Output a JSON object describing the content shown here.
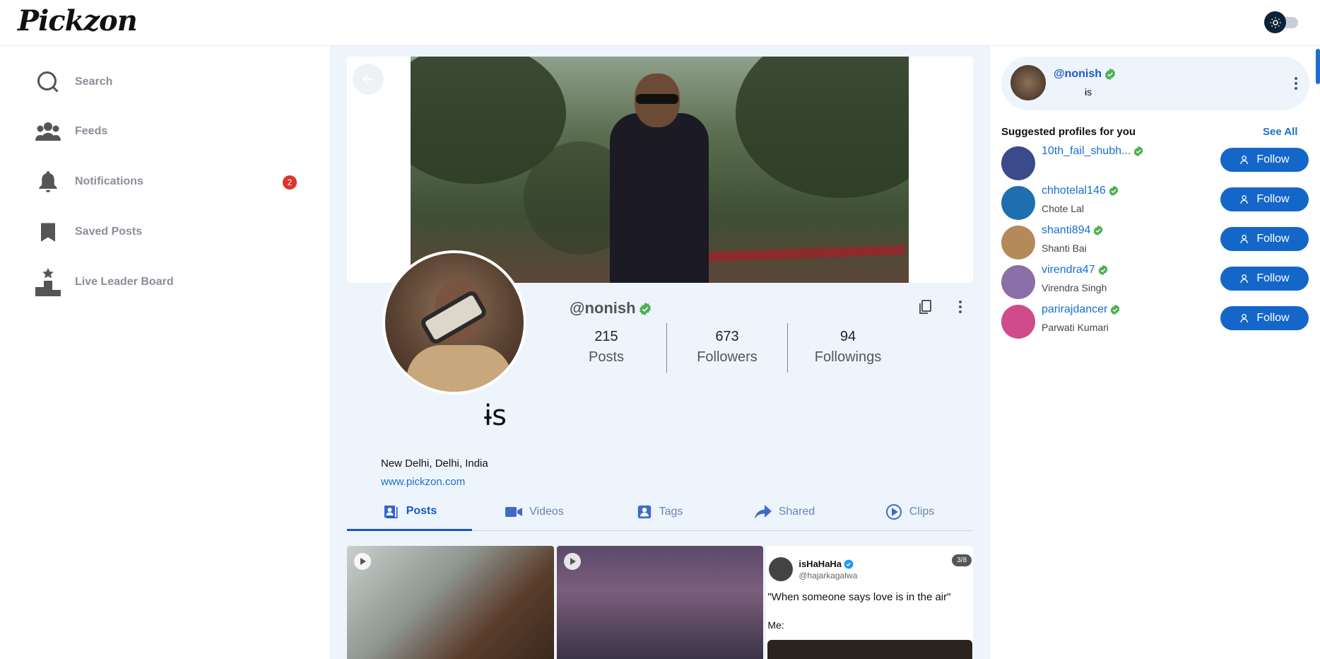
{
  "app": {
    "logo": "Pickzon"
  },
  "header": {
    "theme_toggle": "sun-icon"
  },
  "sidebar": {
    "items": [
      {
        "label": "Search",
        "icon": "search-icon"
      },
      {
        "label": "Feeds",
        "icon": "people-icon"
      },
      {
        "label": "Notifications",
        "icon": "bell-icon",
        "badge": "2"
      },
      {
        "label": "Saved Posts",
        "icon": "bookmark-icon"
      },
      {
        "label": "Live Leader Board",
        "icon": "podium-icon"
      }
    ]
  },
  "profile": {
    "username": "@nonish",
    "display_name": "ɨs",
    "location": "New Delhi, Delhi, India",
    "website": "www.pickzon.com",
    "stats": [
      {
        "num": "215",
        "label": "Posts"
      },
      {
        "num": "673",
        "label": "Followers"
      },
      {
        "num": "94",
        "label": "Followings"
      }
    ],
    "tabs": [
      "Posts",
      "Videos",
      "Tags",
      "Shared",
      "Clips"
    ],
    "active_tab": "Posts"
  },
  "posts": {
    "tweet": {
      "name": "isHaHaHa",
      "handle": "@hajarkagalwa",
      "count": "3/8",
      "text": "\"When someone says love is in the air\"",
      "me": "Me:"
    }
  },
  "right": {
    "me": {
      "username": "@nonish",
      "sub": "ɨs"
    },
    "suggested_title": "Suggested profiles for you",
    "see_all": "See All",
    "follow_label": "Follow",
    "suggestions": [
      {
        "username": "10th_fail_shubh...",
        "name": "",
        "color": "#3a4a8a"
      },
      {
        "username": "chhotelal146",
        "name": "Chote Lal",
        "color": "#1f6fb0"
      },
      {
        "username": "shanti894",
        "name": "Shanti Bai",
        "color": "#b58a5a"
      },
      {
        "username": "virendra47",
        "name": "Virendra Singh",
        "color": "#8b6fa8"
      },
      {
        "username": "parirajdancer",
        "name": "Parwati Kumari",
        "color": "#d14a8a"
      }
    ]
  },
  "colors": {
    "accent": "#1a56c8",
    "link": "#1a6fd0",
    "badge": "#e0332a",
    "verified": "#4caf50"
  }
}
